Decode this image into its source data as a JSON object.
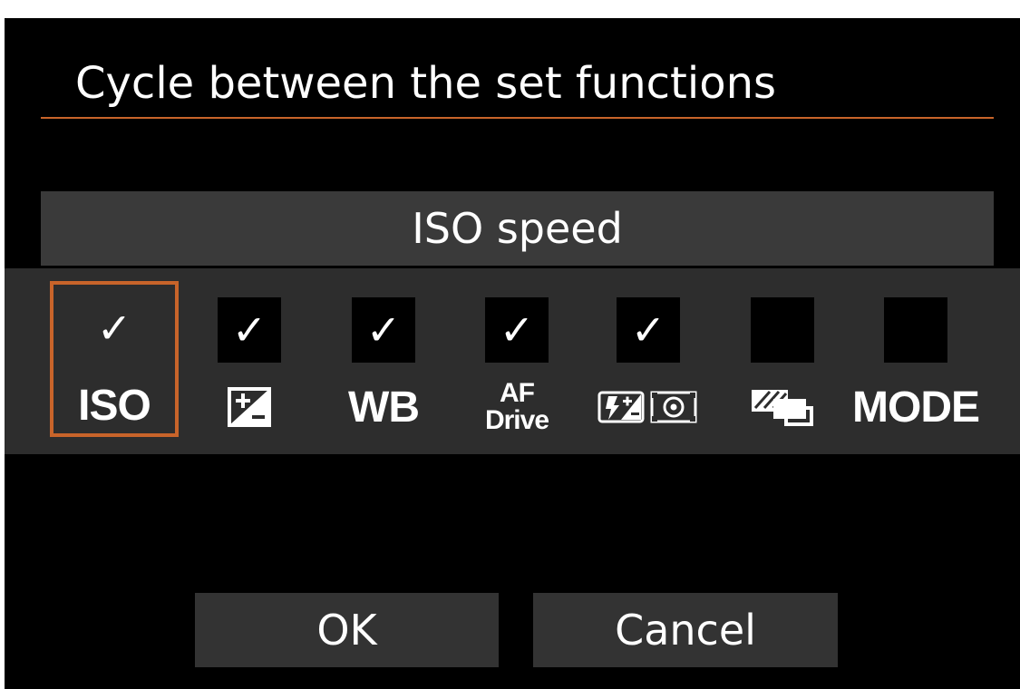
{
  "dialog": {
    "title": "Cycle between the set functions",
    "current_function": "ISO speed"
  },
  "functions": [
    {
      "label": "ISO",
      "icon": "iso-label",
      "checked": true,
      "selected": true
    },
    {
      "label": "",
      "icon": "exposure-compensation-icon",
      "checked": true,
      "selected": false
    },
    {
      "label": "WB",
      "icon": "wb-label",
      "checked": true,
      "selected": false
    },
    {
      "label_line1": "AF",
      "label_line2": "Drive",
      "icon": "af-drive-label",
      "checked": true,
      "selected": false
    },
    {
      "label": "",
      "icon": "flash-exposure-metering-icon",
      "checked": true,
      "selected": false
    },
    {
      "label": "",
      "icon": "multiple-exposure-icon",
      "checked": false,
      "selected": false
    },
    {
      "label": "MODE",
      "icon": "mode-label",
      "checked": false,
      "selected": false
    }
  ],
  "check_mark": "✓",
  "buttons": {
    "ok": "OK",
    "cancel": "Cancel"
  },
  "colors": {
    "accent": "#c8642a",
    "background": "#000000",
    "strip": "#2d2d2d",
    "bar": "#3a3a3a"
  }
}
